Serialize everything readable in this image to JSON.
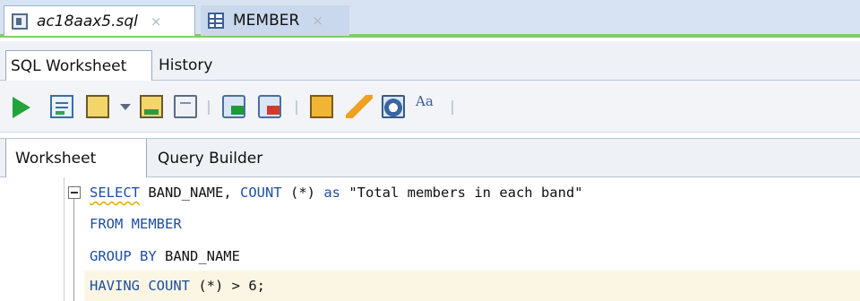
{
  "doc_tabs": [
    {
      "label": "ac18aax5.sql",
      "active": true
    },
    {
      "label": "MEMBER",
      "active": false
    }
  ],
  "close_glyph": "×",
  "sub_tabs": [
    {
      "label": "SQL Worksheet"
    },
    {
      "label": "History"
    }
  ],
  "toolbar": {
    "format_glyph": "Aa"
  },
  "worksheet_tabs": [
    {
      "label": "Worksheet"
    },
    {
      "label": "Query Builder"
    }
  ],
  "editor": {
    "line1": {
      "kw1": "SELECT",
      "t1": " BAND_NAME, ",
      "kw2": "COUNT",
      "t2": " (*) ",
      "kw3": "as",
      "t3": " ",
      "str": "\"Total members in each band\""
    },
    "line2": {
      "kw1": "FROM",
      "t1": " ",
      "kw2": "MEMBER"
    },
    "line3": {
      "kw1": "GROUP BY",
      "t1": " BAND_NAME"
    },
    "line4": {
      "kw1": "HAVING",
      "t1": " ",
      "kw2": "COUNT",
      "t2": " (*) > 6;"
    }
  },
  "colors": {
    "accent_green": "#7ccc73",
    "keyword_blue": "#1c4fa3",
    "current_line": "#fbf6e3"
  }
}
